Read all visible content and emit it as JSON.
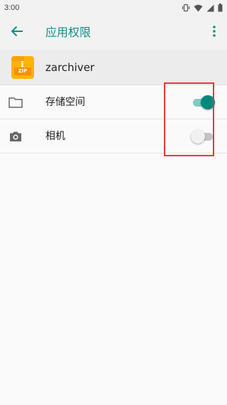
{
  "status_bar": {
    "time": "3:00"
  },
  "toolbar": {
    "title": "应用权限",
    "back_icon": "arrow-left-icon",
    "menu_icon": "more-vert-icon",
    "accent_color": "#118f82"
  },
  "app": {
    "name": "zarchiver",
    "icon": "zip-folder-icon",
    "icon_label": "ZIP"
  },
  "permissions": [
    {
      "label": "存储空间",
      "icon": "folder-icon",
      "enabled": true
    },
    {
      "label": "相机",
      "icon": "camera-icon",
      "enabled": false
    }
  ],
  "colors": {
    "switch_on": "#00897b",
    "switch_on_track": "#80cbc4",
    "highlight": "#e53935"
  }
}
